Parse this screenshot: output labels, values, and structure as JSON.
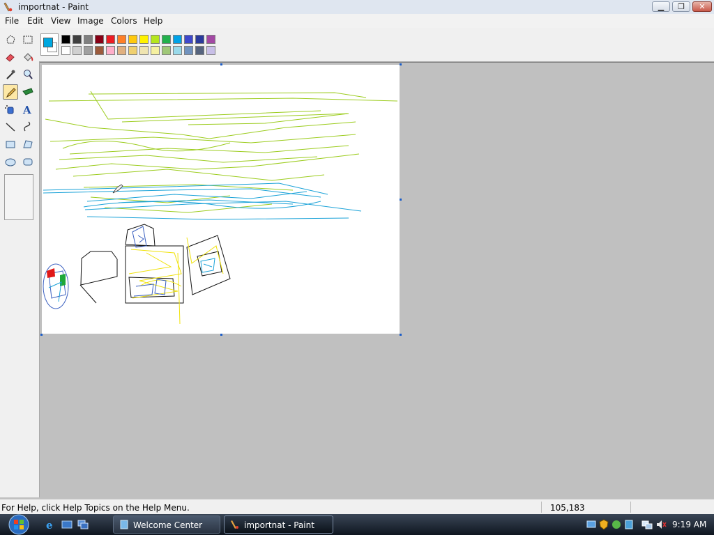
{
  "window": {
    "title": "importnat - Paint"
  },
  "menu": [
    "File",
    "Edit",
    "View",
    "Image",
    "Colors",
    "Help"
  ],
  "toolbox": {
    "tools": [
      "free-form-select",
      "select",
      "eraser",
      "fill-with-color",
      "pick-color",
      "magnifier",
      "pencil",
      "brush",
      "airbrush",
      "text",
      "line",
      "curve",
      "rectangle",
      "polygon",
      "ellipse",
      "rounded-rectangle"
    ],
    "selected_tool": "pencil"
  },
  "palette": {
    "foreground": "#00a8e0",
    "background": "#ffffff",
    "colors_row1": [
      "#000000",
      "#404040",
      "#808080",
      "#880015",
      "#ed1c24",
      "#ff7f27",
      "#ffc90e",
      "#fff200",
      "#b5e61d",
      "#22b14c",
      "#00a2e8",
      "#3f48cc",
      "#2a3a9c",
      "#a349a4"
    ],
    "colors_row2": [
      "#ffffff",
      "#d0d0d0",
      "#a0a0a0",
      "#9c5a3c",
      "#ffaec9",
      "#e0b080",
      "#f0d070",
      "#efe4b0",
      "#f5f0a0",
      "#a0c878",
      "#99d9ea",
      "#7092be",
      "#56647e",
      "#c8bfe7"
    ]
  },
  "status": {
    "help_text": "For Help, click Help Topics on the Help Menu.",
    "coordinates": "105,183"
  },
  "taskbar": {
    "buttons": [
      {
        "label": "Welcome Center"
      },
      {
        "label": "importnat - Paint"
      }
    ],
    "clock": "9:19 AM"
  }
}
